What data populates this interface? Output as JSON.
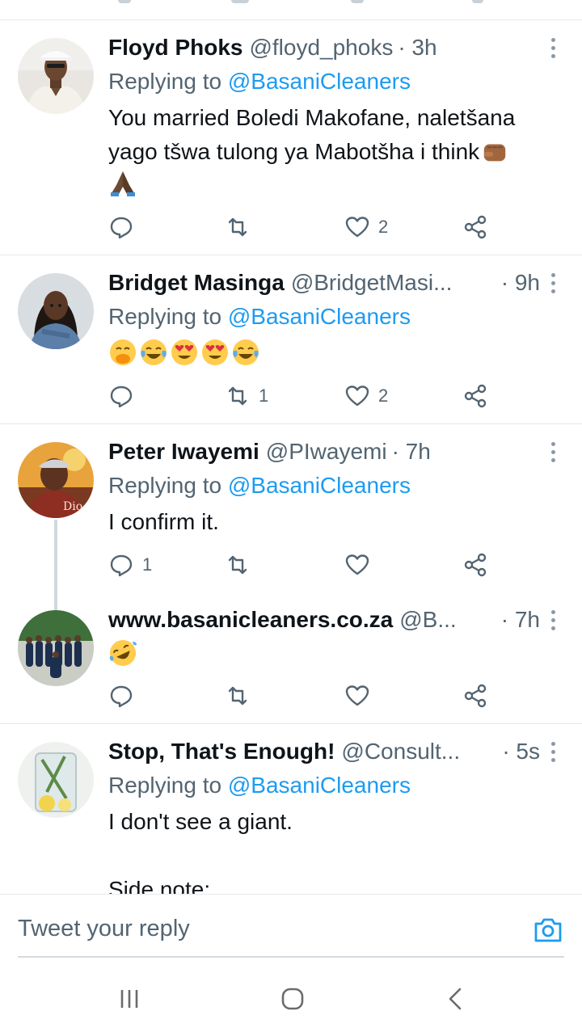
{
  "tweets": [
    {
      "name": "Floyd Phoks",
      "handle": "@floyd_phoks",
      "time": "· 3h",
      "replying_prefix": "Replying to",
      "replying_handle": "@BasaniCleaners",
      "text_line1": "You married Boledi Makofane, naletšana",
      "text_line2": "yago tšwa tulong ya Mabotšha i think",
      "emojis": [
        "fist-emoji",
        "praying-hands-emoji"
      ],
      "replies": "",
      "retweets": "",
      "likes": "2"
    },
    {
      "name": "Bridget Masinga",
      "handle": "@BridgetMasi...",
      "time": "· 9h",
      "replying_prefix": "Replying to",
      "replying_handle": "@BasaniCleaners",
      "emojis": [
        "hand-over-mouth-emoji",
        "tears-of-joy-emoji",
        "heart-eyes-emoji",
        "heart-eyes-emoji",
        "tears-of-joy-emoji"
      ],
      "replies": "",
      "retweets": "1",
      "likes": "2"
    },
    {
      "name": "Peter Iwayemi",
      "handle": "@PIwayemi",
      "time": "· 7h",
      "replying_prefix": "Replying to",
      "replying_handle": "@BasaniCleaners",
      "text": "I confirm it.",
      "replies": "1",
      "retweets": "",
      "likes": ""
    },
    {
      "name": "www.basanicleaners.co.za",
      "handle": "@B...",
      "time": "· 7h",
      "emojis": [
        "rolling-laughing-emoji"
      ],
      "replies": "",
      "retweets": "",
      "likes": ""
    },
    {
      "name": "Stop, That's Enough!",
      "handle": "@Consult...",
      "time": "· 5s",
      "replying_prefix": "Replying to",
      "replying_handle": "@BasaniCleaners",
      "text_line1": "I don't see a giant.",
      "text_line2": "Side note:"
    }
  ],
  "reply_bar": {
    "placeholder": "Tweet your reply"
  },
  "navbar": {
    "recent": "recent-apps",
    "home": "home",
    "back": "back"
  },
  "colors": {
    "accent": "#1d9bf0",
    "secondary_text": "#536471",
    "primary_text": "#0f1419"
  }
}
